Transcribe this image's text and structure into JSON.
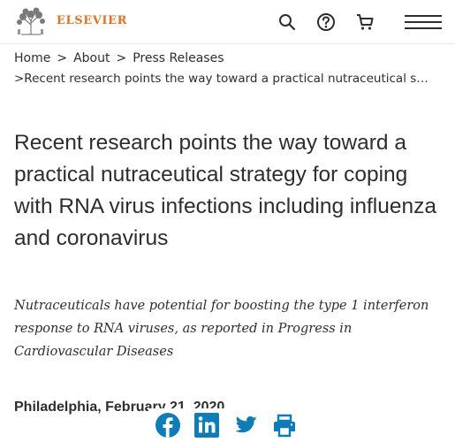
{
  "header": {
    "logo_text": "ELSEVIER",
    "logo_icon": "elsevier-tree-logo",
    "icons": [
      "search-icon",
      "help-icon",
      "cart-icon",
      "menu-icon"
    ]
  },
  "breadcrumb": {
    "items": [
      "Home",
      "About",
      "Press Releases"
    ],
    "separator": ">",
    "current": ">Recent research points the way toward a practical nutraceutical strate..."
  },
  "article": {
    "title": "Recent research points the way toward a practical nutraceutical strategy for coping with RNA virus infections including influenza and coronavirus",
    "subtitle": "Nutraceuticals have potential for boosting the type 1 interferon response to RNA viruses, as reported in Progress in Cardiovascular Diseases",
    "dateline": "Philadelphia, February 21, 2020"
  },
  "share": {
    "icons": [
      "facebook-icon",
      "linkedin-icon",
      "twitter-icon",
      "print-icon"
    ],
    "color": "#0c7dbb"
  },
  "colors": {
    "brand_orange": "#e9711c",
    "text": "#2e2e2e",
    "share_blue": "#0c7dbb"
  }
}
